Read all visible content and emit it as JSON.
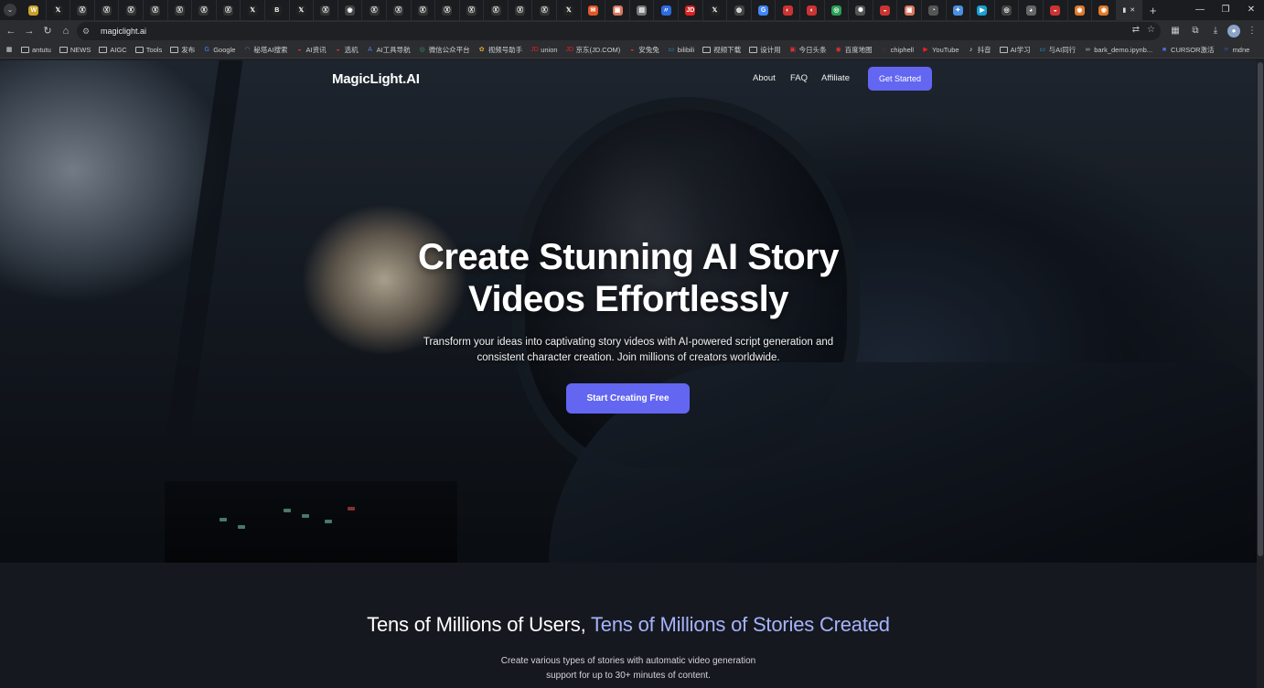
{
  "browser": {
    "tabs": [
      {
        "glyph": "W",
        "color": "#c9a227"
      },
      {
        "glyph": "𝕏",
        "color": "#222"
      },
      {
        "glyph": "Ⓧ",
        "color": "#333"
      },
      {
        "glyph": "Ⓧ",
        "color": "#333"
      },
      {
        "glyph": "Ⓧ",
        "color": "#333"
      },
      {
        "glyph": "Ⓧ",
        "color": "#333"
      },
      {
        "glyph": "Ⓧ",
        "color": "#333"
      },
      {
        "glyph": "Ⓧ",
        "color": "#333"
      },
      {
        "glyph": "Ⓧ",
        "color": "#333"
      },
      {
        "glyph": "𝕏",
        "color": "#222"
      },
      {
        "glyph": "B",
        "color": "#222"
      },
      {
        "glyph": "𝕏",
        "color": "#222"
      },
      {
        "glyph": "Ⓧ",
        "color": "#333"
      },
      {
        "glyph": "◉",
        "color": "#444"
      },
      {
        "glyph": "Ⓧ",
        "color": "#333"
      },
      {
        "glyph": "Ⓧ",
        "color": "#333"
      },
      {
        "glyph": "Ⓧ",
        "color": "#333"
      },
      {
        "glyph": "Ⓧ",
        "color": "#333"
      },
      {
        "glyph": "Ⓧ",
        "color": "#333"
      },
      {
        "glyph": "Ⓧ",
        "color": "#333"
      },
      {
        "glyph": "Ⓧ",
        "color": "#333"
      },
      {
        "glyph": "Ⓧ",
        "color": "#333"
      },
      {
        "glyph": "𝕏",
        "color": "#222"
      },
      {
        "glyph": "✉",
        "color": "#e0582a"
      },
      {
        "glyph": "▣",
        "color": "#d9775f"
      },
      {
        "glyph": "▤",
        "color": "#777"
      },
      {
        "glyph": "〃",
        "color": "#2d6be0"
      },
      {
        "glyph": "JD",
        "color": "#d22"
      },
      {
        "glyph": "𝕏",
        "color": "#222"
      },
      {
        "glyph": "◍",
        "color": "#444"
      },
      {
        "glyph": "G",
        "color": "#4285f4"
      },
      {
        "glyph": "◐",
        "color": "#c33"
      },
      {
        "glyph": "◐",
        "color": "#c33"
      },
      {
        "glyph": "◎",
        "color": "#2a9d55"
      },
      {
        "glyph": "✺",
        "color": "#555"
      },
      {
        "glyph": "◒",
        "color": "#c33"
      },
      {
        "glyph": "▣",
        "color": "#d9775f"
      },
      {
        "glyph": "◔",
        "color": "#555"
      },
      {
        "glyph": "✦",
        "color": "#4a8fe0"
      },
      {
        "glyph": "▶",
        "color": "#1a9fd6"
      },
      {
        "glyph": "◎",
        "color": "#444"
      },
      {
        "glyph": "◕",
        "color": "#666"
      },
      {
        "glyph": "◒",
        "color": "#c33"
      },
      {
        "glyph": "◉",
        "color": "#e07a2a"
      },
      {
        "glyph": "◉",
        "color": "#e07a2a"
      }
    ],
    "active_tab_glyph": "▮",
    "active_tab_close": "✕",
    "address": "magiclight.ai",
    "bookmarks": [
      {
        "label": "antutu",
        "type": "folder"
      },
      {
        "label": "NEWS",
        "type": "folder"
      },
      {
        "label": "AIGC",
        "type": "folder"
      },
      {
        "label": "Tools",
        "type": "folder"
      },
      {
        "label": "发布",
        "type": "folder"
      },
      {
        "label": "Google",
        "type": "site",
        "glyph": "G",
        "color": "#4285f4"
      },
      {
        "label": "秘塔AI搜索",
        "type": "site",
        "glyph": "◠",
        "color": "#5577dd"
      },
      {
        "label": "AI资讯",
        "type": "site",
        "glyph": "◒",
        "color": "#d33"
      },
      {
        "label": "选机",
        "type": "site",
        "glyph": "◒",
        "color": "#d33"
      },
      {
        "label": "AI工具导航",
        "type": "site",
        "glyph": "A",
        "color": "#5a7be0"
      },
      {
        "label": "微信公众平台",
        "type": "site",
        "glyph": "◎",
        "color": "#2aa15a"
      },
      {
        "label": "视频号助手",
        "type": "site",
        "glyph": "✿",
        "color": "#e0a82a"
      },
      {
        "label": "union",
        "type": "site",
        "glyph": "JD",
        "color": "#d22"
      },
      {
        "label": "京东(JD.COM)",
        "type": "site",
        "glyph": "JD",
        "color": "#d22"
      },
      {
        "label": "安兔兔",
        "type": "site",
        "glyph": "◒",
        "color": "#d33"
      },
      {
        "label": "bilibili",
        "type": "site",
        "glyph": "▭",
        "color": "#2aa0d8"
      },
      {
        "label": "视频下载",
        "type": "folder"
      },
      {
        "label": "设计用",
        "type": "folder"
      },
      {
        "label": "今日头条",
        "type": "site",
        "glyph": "▣",
        "color": "#d33"
      },
      {
        "label": "百度地图",
        "type": "site",
        "glyph": "◉",
        "color": "#d33"
      },
      {
        "label": "chiphell",
        "type": "site",
        "glyph": "◌",
        "color": "#c33"
      },
      {
        "label": "YouTube",
        "type": "site",
        "glyph": "▶",
        "color": "#e22"
      },
      {
        "label": "抖音",
        "type": "site",
        "glyph": "♪",
        "color": "#eee"
      },
      {
        "label": "AI学习",
        "type": "folder"
      },
      {
        "label": "与AI同行",
        "type": "site",
        "glyph": "▭",
        "color": "#2aa0d8"
      },
      {
        "label": "bark_demo.ipynb...",
        "type": "site",
        "glyph": "∞",
        "color": "#bbb"
      },
      {
        "label": "CURSOR激活",
        "type": "site",
        "glyph": "■",
        "color": "#4a6ee0"
      },
      {
        "label": "mdne",
        "type": "site",
        "glyph": "〃",
        "color": "#2d6be0"
      }
    ]
  },
  "site": {
    "logo": "MagicLight.AI",
    "nav": [
      {
        "label": "About"
      },
      {
        "label": "FAQ"
      },
      {
        "label": "Affiliate"
      }
    ],
    "nav_cta": "Get Started"
  },
  "hero": {
    "title_line1": "Create Stunning AI Story",
    "title_line2": "Videos Effortlessly",
    "subtitle_line1": "Transform your ideas into captivating story videos with AI-powered script generation and",
    "subtitle_line2": "consistent character creation. Join millions of creators worldwide.",
    "cta": "Start Creating Free"
  },
  "stats": {
    "title_part1": "Tens of Millions of Users, ",
    "title_part2": "Tens of Millions of Stories Created",
    "subtitle_line1": "Create various types of stories with automatic video generation",
    "subtitle_line2": "support for up to 30+ minutes of content."
  }
}
